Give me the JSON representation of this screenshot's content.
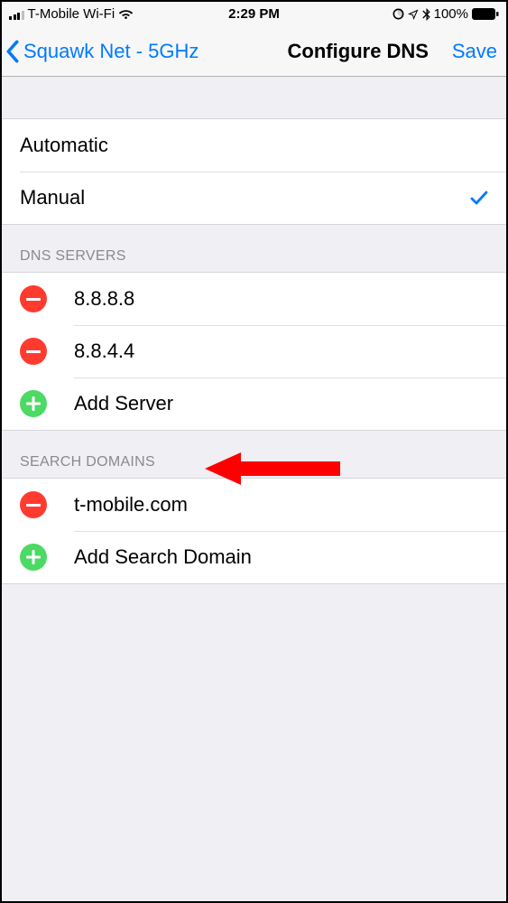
{
  "status_bar": {
    "carrier": "T-Mobile Wi-Fi",
    "time": "2:29 PM",
    "battery_pct": "100%"
  },
  "nav": {
    "back_label": "Squawk Net - 5GHz",
    "title": "Configure DNS",
    "save_label": "Save"
  },
  "mode": {
    "options": [
      {
        "label": "Automatic",
        "selected": false
      },
      {
        "label": "Manual",
        "selected": true
      }
    ]
  },
  "dns_section": {
    "header": "DNS SERVERS",
    "servers": [
      {
        "value": "8.8.8.8"
      },
      {
        "value": "8.8.4.4"
      }
    ],
    "add_label": "Add Server"
  },
  "search_section": {
    "header": "SEARCH DOMAINS",
    "domains": [
      {
        "value": "t-mobile.com"
      }
    ],
    "add_label": "Add Search Domain"
  }
}
